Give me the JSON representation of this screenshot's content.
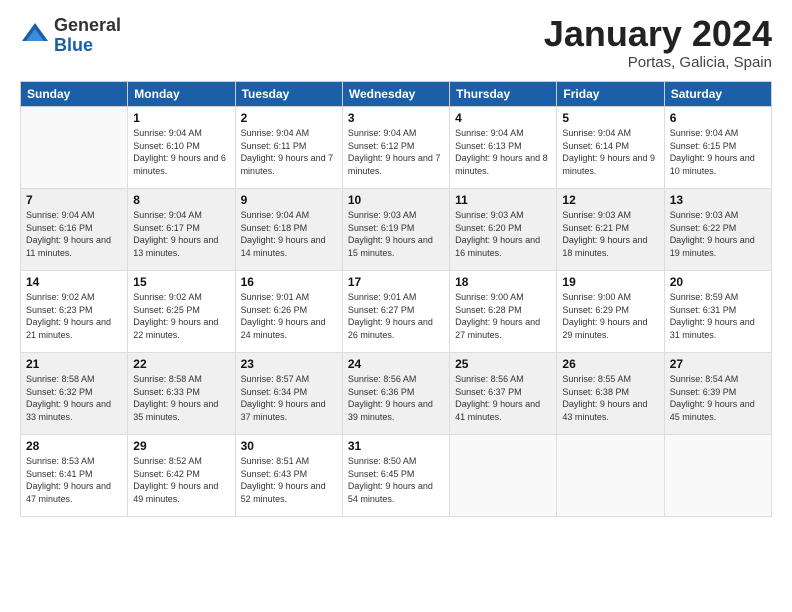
{
  "header": {
    "logo_general": "General",
    "logo_blue": "Blue",
    "month_title": "January 2024",
    "location": "Portas, Galicia, Spain"
  },
  "days_of_week": [
    "Sunday",
    "Monday",
    "Tuesday",
    "Wednesday",
    "Thursday",
    "Friday",
    "Saturday"
  ],
  "weeks": [
    [
      {
        "day": "",
        "sunrise": "",
        "sunset": "",
        "daylight": ""
      },
      {
        "day": "1",
        "sunrise": "Sunrise: 9:04 AM",
        "sunset": "Sunset: 6:10 PM",
        "daylight": "Daylight: 9 hours and 6 minutes."
      },
      {
        "day": "2",
        "sunrise": "Sunrise: 9:04 AM",
        "sunset": "Sunset: 6:11 PM",
        "daylight": "Daylight: 9 hours and 7 minutes."
      },
      {
        "day": "3",
        "sunrise": "Sunrise: 9:04 AM",
        "sunset": "Sunset: 6:12 PM",
        "daylight": "Daylight: 9 hours and 7 minutes."
      },
      {
        "day": "4",
        "sunrise": "Sunrise: 9:04 AM",
        "sunset": "Sunset: 6:13 PM",
        "daylight": "Daylight: 9 hours and 8 minutes."
      },
      {
        "day": "5",
        "sunrise": "Sunrise: 9:04 AM",
        "sunset": "Sunset: 6:14 PM",
        "daylight": "Daylight: 9 hours and 9 minutes."
      },
      {
        "day": "6",
        "sunrise": "Sunrise: 9:04 AM",
        "sunset": "Sunset: 6:15 PM",
        "daylight": "Daylight: 9 hours and 10 minutes."
      }
    ],
    [
      {
        "day": "7",
        "sunrise": "Sunrise: 9:04 AM",
        "sunset": "Sunset: 6:16 PM",
        "daylight": "Daylight: 9 hours and 11 minutes."
      },
      {
        "day": "8",
        "sunrise": "Sunrise: 9:04 AM",
        "sunset": "Sunset: 6:17 PM",
        "daylight": "Daylight: 9 hours and 13 minutes."
      },
      {
        "day": "9",
        "sunrise": "Sunrise: 9:04 AM",
        "sunset": "Sunset: 6:18 PM",
        "daylight": "Daylight: 9 hours and 14 minutes."
      },
      {
        "day": "10",
        "sunrise": "Sunrise: 9:03 AM",
        "sunset": "Sunset: 6:19 PM",
        "daylight": "Daylight: 9 hours and 15 minutes."
      },
      {
        "day": "11",
        "sunrise": "Sunrise: 9:03 AM",
        "sunset": "Sunset: 6:20 PM",
        "daylight": "Daylight: 9 hours and 16 minutes."
      },
      {
        "day": "12",
        "sunrise": "Sunrise: 9:03 AM",
        "sunset": "Sunset: 6:21 PM",
        "daylight": "Daylight: 9 hours and 18 minutes."
      },
      {
        "day": "13",
        "sunrise": "Sunrise: 9:03 AM",
        "sunset": "Sunset: 6:22 PM",
        "daylight": "Daylight: 9 hours and 19 minutes."
      }
    ],
    [
      {
        "day": "14",
        "sunrise": "Sunrise: 9:02 AM",
        "sunset": "Sunset: 6:23 PM",
        "daylight": "Daylight: 9 hours and 21 minutes."
      },
      {
        "day": "15",
        "sunrise": "Sunrise: 9:02 AM",
        "sunset": "Sunset: 6:25 PM",
        "daylight": "Daylight: 9 hours and 22 minutes."
      },
      {
        "day": "16",
        "sunrise": "Sunrise: 9:01 AM",
        "sunset": "Sunset: 6:26 PM",
        "daylight": "Daylight: 9 hours and 24 minutes."
      },
      {
        "day": "17",
        "sunrise": "Sunrise: 9:01 AM",
        "sunset": "Sunset: 6:27 PM",
        "daylight": "Daylight: 9 hours and 26 minutes."
      },
      {
        "day": "18",
        "sunrise": "Sunrise: 9:00 AM",
        "sunset": "Sunset: 6:28 PM",
        "daylight": "Daylight: 9 hours and 27 minutes."
      },
      {
        "day": "19",
        "sunrise": "Sunrise: 9:00 AM",
        "sunset": "Sunset: 6:29 PM",
        "daylight": "Daylight: 9 hours and 29 minutes."
      },
      {
        "day": "20",
        "sunrise": "Sunrise: 8:59 AM",
        "sunset": "Sunset: 6:31 PM",
        "daylight": "Daylight: 9 hours and 31 minutes."
      }
    ],
    [
      {
        "day": "21",
        "sunrise": "Sunrise: 8:58 AM",
        "sunset": "Sunset: 6:32 PM",
        "daylight": "Daylight: 9 hours and 33 minutes."
      },
      {
        "day": "22",
        "sunrise": "Sunrise: 8:58 AM",
        "sunset": "Sunset: 6:33 PM",
        "daylight": "Daylight: 9 hours and 35 minutes."
      },
      {
        "day": "23",
        "sunrise": "Sunrise: 8:57 AM",
        "sunset": "Sunset: 6:34 PM",
        "daylight": "Daylight: 9 hours and 37 minutes."
      },
      {
        "day": "24",
        "sunrise": "Sunrise: 8:56 AM",
        "sunset": "Sunset: 6:36 PM",
        "daylight": "Daylight: 9 hours and 39 minutes."
      },
      {
        "day": "25",
        "sunrise": "Sunrise: 8:56 AM",
        "sunset": "Sunset: 6:37 PM",
        "daylight": "Daylight: 9 hours and 41 minutes."
      },
      {
        "day": "26",
        "sunrise": "Sunrise: 8:55 AM",
        "sunset": "Sunset: 6:38 PM",
        "daylight": "Daylight: 9 hours and 43 minutes."
      },
      {
        "day": "27",
        "sunrise": "Sunrise: 8:54 AM",
        "sunset": "Sunset: 6:39 PM",
        "daylight": "Daylight: 9 hours and 45 minutes."
      }
    ],
    [
      {
        "day": "28",
        "sunrise": "Sunrise: 8:53 AM",
        "sunset": "Sunset: 6:41 PM",
        "daylight": "Daylight: 9 hours and 47 minutes."
      },
      {
        "day": "29",
        "sunrise": "Sunrise: 8:52 AM",
        "sunset": "Sunset: 6:42 PM",
        "daylight": "Daylight: 9 hours and 49 minutes."
      },
      {
        "day": "30",
        "sunrise": "Sunrise: 8:51 AM",
        "sunset": "Sunset: 6:43 PM",
        "daylight": "Daylight: 9 hours and 52 minutes."
      },
      {
        "day": "31",
        "sunrise": "Sunrise: 8:50 AM",
        "sunset": "Sunset: 6:45 PM",
        "daylight": "Daylight: 9 hours and 54 minutes."
      },
      {
        "day": "",
        "sunrise": "",
        "sunset": "",
        "daylight": ""
      },
      {
        "day": "",
        "sunrise": "",
        "sunset": "",
        "daylight": ""
      },
      {
        "day": "",
        "sunrise": "",
        "sunset": "",
        "daylight": ""
      }
    ]
  ]
}
